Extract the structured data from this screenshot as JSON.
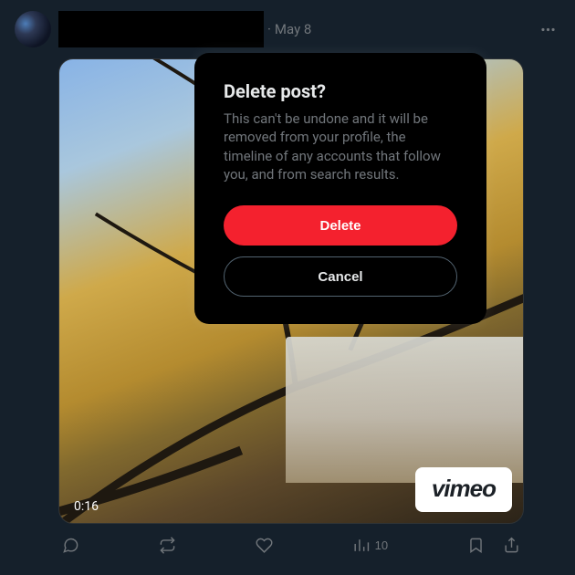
{
  "post": {
    "date": "May 8",
    "separator": "·",
    "video_duration": "0:16",
    "brand": "vimeo"
  },
  "actions": {
    "views_count": "10"
  },
  "modal": {
    "title": "Delete post?",
    "body": "This can't be undone and it will be removed from your profile, the timeline of any accounts that follow you, and from search results.",
    "confirm_label": "Delete",
    "cancel_label": "Cancel"
  }
}
